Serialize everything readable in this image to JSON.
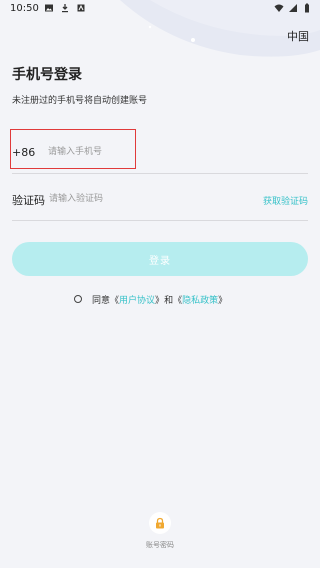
{
  "status_bar": {
    "time": "10:50",
    "left_icons": [
      "image-icon",
      "download-icon",
      "app-icon"
    ],
    "right_icons": [
      "wifi-icon",
      "signal-icon",
      "battery-icon"
    ]
  },
  "header": {
    "region": "中国"
  },
  "login": {
    "title": "手机号登录",
    "subtitle": "未注册过的手机号将自动创建账号",
    "country_code": "+86",
    "phone_placeholder": "请输入手机号",
    "code_label": "验证码",
    "code_placeholder": "请输入验证码",
    "get_code": "获取验证码",
    "submit": "登录"
  },
  "agreement": {
    "prefix": "同意",
    "open_quote_1": "《",
    "user_agreement": "用户协议",
    "close_quote_1": "》",
    "conjunction": "和",
    "open_quote_2": "《",
    "privacy_policy": "隐私政策",
    "close_quote_2": "》"
  },
  "alt_login": {
    "label": "账号密码",
    "icon": "lock-icon"
  },
  "colors": {
    "accent": "#38c2c9",
    "button_bg": "#b6edef",
    "background": "#f3f4f8",
    "highlight": "#e03a3a"
  }
}
